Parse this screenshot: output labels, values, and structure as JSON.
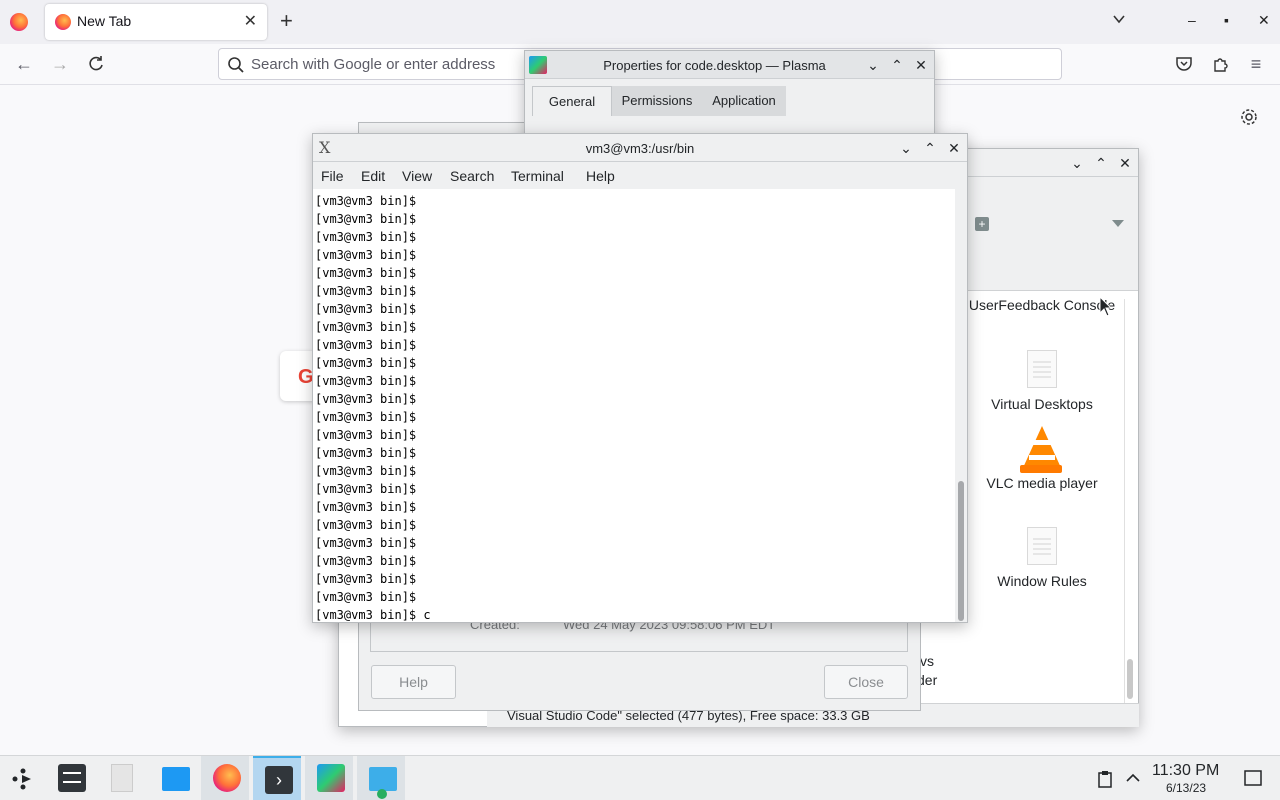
{
  "firefox": {
    "tab_title": "New Tab",
    "tab_close": "✕",
    "new_tab": "+",
    "search_placeholder": "Search with Google or enter address",
    "min": "–",
    "max": "▪",
    "close": "✕"
  },
  "dolphin": {
    "items": [
      {
        "label": "UserFeedback Console"
      },
      {
        "label": "Virtual Desktops"
      },
      {
        "label": "VLC media player"
      },
      {
        "label": "Window Rules"
      }
    ],
    "partial_1": "vs",
    "partial_2": "der",
    "status": "Visual Studio Code\" selected (477 bytes), Free space: 33.3 GB"
  },
  "properties": {
    "title": "Properties for code.desktop — Plasma",
    "tabs": [
      "General",
      "Permissions",
      "Application"
    ],
    "created_label": "Created:",
    "created_value": "Wed 24 May 2023 09:58:06 PM EDT",
    "help_button": "Help",
    "close_button": "Close"
  },
  "terminal": {
    "title": "vm3@vm3:/usr/bin",
    "menu": [
      "File",
      "Edit",
      "View",
      "Search",
      "Terminal",
      "Help"
    ],
    "lines": [
      "[vm3@vm3 bin]$",
      "[vm3@vm3 bin]$",
      "[vm3@vm3 bin]$",
      "[vm3@vm3 bin]$",
      "[vm3@vm3 bin]$",
      "[vm3@vm3 bin]$",
      "[vm3@vm3 bin]$",
      "[vm3@vm3 bin]$",
      "[vm3@vm3 bin]$",
      "[vm3@vm3 bin]$",
      "[vm3@vm3 bin]$",
      "[vm3@vm3 bin]$",
      "[vm3@vm3 bin]$",
      "[vm3@vm3 bin]$",
      "[vm3@vm3 bin]$",
      "[vm3@vm3 bin]$",
      "[vm3@vm3 bin]$",
      "[vm3@vm3 bin]$",
      "[vm3@vm3 bin]$",
      "[vm3@vm3 bin]$",
      "[vm3@vm3 bin]$",
      "[vm3@vm3 bin]$",
      "[vm3@vm3 bin]$",
      "[vm3@vm3 bin]$ c"
    ]
  },
  "taskbar": {
    "time": "11:30 PM",
    "date": "6/13/23",
    "apps": [
      {
        "name": "system-settings-icon"
      },
      {
        "name": "text-file-icon"
      },
      {
        "name": "folder-icon"
      },
      {
        "name": "firefox-icon"
      },
      {
        "name": "konsole-icon"
      },
      {
        "name": "kate-icon"
      },
      {
        "name": "folder-add-icon"
      }
    ]
  },
  "colors": {
    "accent": "#3daee9",
    "window_bg": "#eff0f1"
  }
}
